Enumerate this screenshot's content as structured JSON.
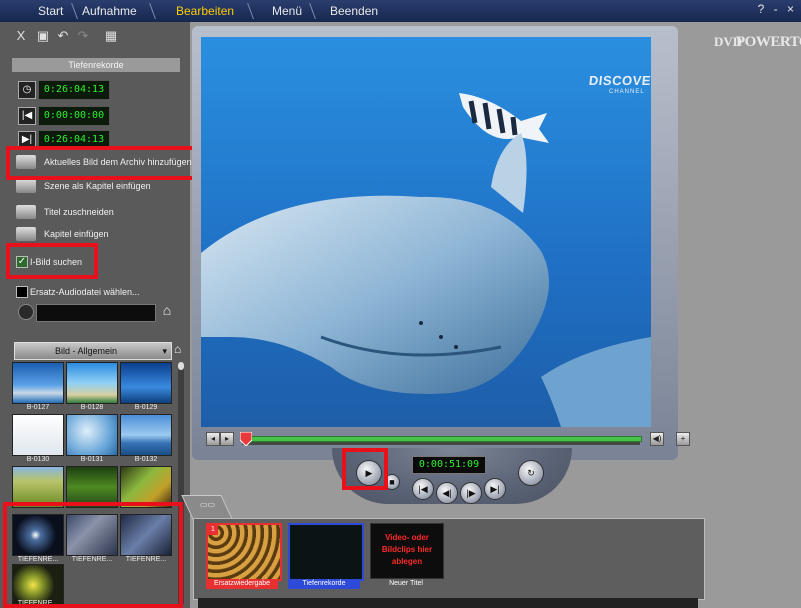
{
  "nav": {
    "items": [
      "Start",
      "Aufnahme",
      "Bearbeiten",
      "Menü",
      "Beenden"
    ],
    "active": "Bearbeiten",
    "window_controls": "? - ×"
  },
  "left": {
    "section_title": "Tiefenrekorde",
    "timecodes": [
      "0:26:04:13",
      "0:00:00:00",
      "0:26:04:13"
    ],
    "actions": [
      "Aktuelles Bild dem Archiv hinzufügen",
      "Szene als Kapitel einfügen",
      "Titel zuschneiden",
      "Kapitel einfügen"
    ],
    "iframe_label": "I-Bild suchen",
    "iframe_checked": true,
    "audio_label": "Ersatz-Audiodatei wählen..."
  },
  "library": {
    "category": "Bild - Allgemein",
    "row1": [
      "B-0127",
      "B-0128",
      "B-0129"
    ],
    "row2": [
      "B-0130",
      "B-0131",
      "B-0132"
    ],
    "row4": [
      "TIEFENRE...",
      "TIEFENRE...",
      "TIEFENRE..."
    ],
    "row5": [
      "TIEFENRE..."
    ]
  },
  "video": {
    "logo_line1": "DISCOVERY",
    "logo_line2": "CHANNEL",
    "timecode": "0:00:51:09"
  },
  "brand": {
    "line1": "DVD",
    "line2": "POWERTOOL"
  },
  "timeline": {
    "clips": [
      {
        "label": "Ersatzwiedergabe",
        "number": "1"
      },
      {
        "label": "Tiefenrekorde",
        "number": ""
      },
      {
        "label": "Neuer Titel",
        "drop_text": "Video- oder Bildclips hier ablegen"
      }
    ]
  },
  "colors": {
    "highlight": "#e8101a",
    "timecode_green": "#2ef02e",
    "active_nav": "#ffcc00"
  }
}
